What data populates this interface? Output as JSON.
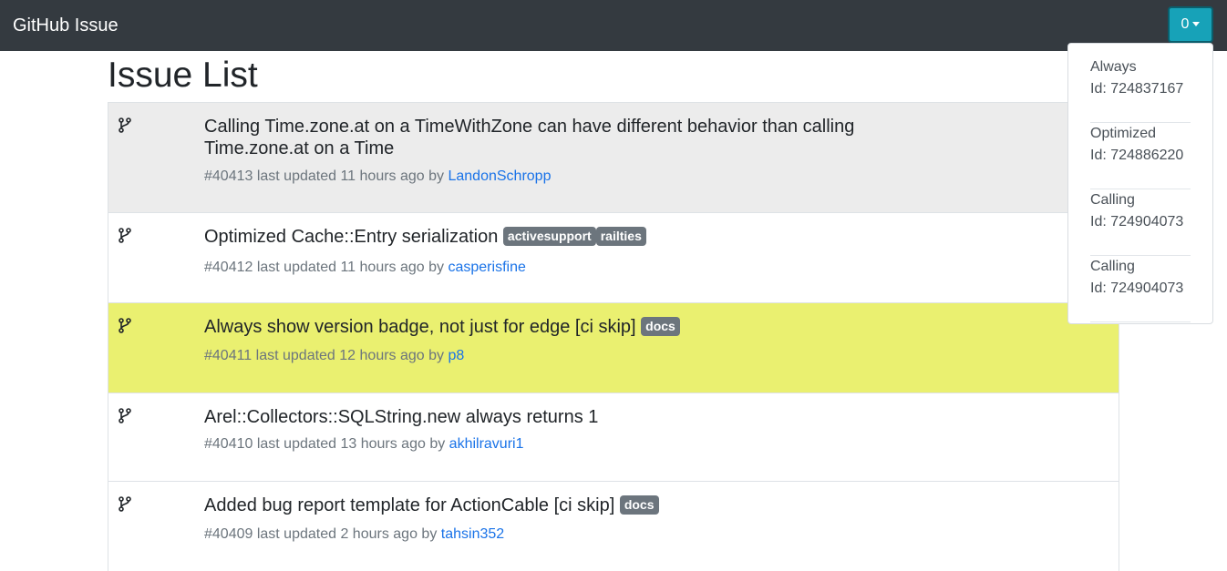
{
  "navbar": {
    "brand": "GitHub Issue",
    "counter_button": "0"
  },
  "page_title": "Issue List",
  "issues": [
    {
      "title": "Calling Time.zone.at on a TimeWithZone can have different behavior than calling Time.zone.at on a Time",
      "labels": [],
      "meta": "#40413 last updated 11 hours ago by",
      "author": "LandonSchropp",
      "background": "#ececec"
    },
    {
      "title": "Optimized Cache::Entry serialization",
      "labels": [
        "activesupport",
        "railties"
      ],
      "meta": "#40412 last updated 11 hours ago by",
      "author": "casperisfine",
      "background": "#ffffff"
    },
    {
      "title": "Always show version badge, not just for edge [ci skip]",
      "labels": [
        "docs"
      ],
      "meta": "#40411 last updated 12 hours ago by",
      "author": "p8",
      "background": "#eaf070"
    },
    {
      "title": "Arel::Collectors::SQLString.new always returns 1",
      "labels": [],
      "meta": "#40410 last updated 13 hours ago by",
      "author": "akhilravuri1",
      "background": "#ffffff"
    },
    {
      "title": "Added bug report template for ActionCable [ci skip]",
      "labels": [
        "docs"
      ],
      "meta": "#40409 last updated 2 hours ago by",
      "author": "tahsin352",
      "background": "#ffffff"
    }
  ],
  "dropdown": {
    "items": [
      {
        "name": "Always",
        "id": "Id: 724837167"
      },
      {
        "name": "Optimized",
        "id": "Id: 724886220"
      },
      {
        "name": "Calling",
        "id": "Id: 724904073"
      },
      {
        "name": "Calling",
        "id": "Id: 724904073"
      }
    ]
  },
  "icons": {
    "issue_icon": "git-branch-icon",
    "caret": "caret-down-icon"
  },
  "colors": {
    "navbar": "#343a40",
    "counter_button": "#17a2b8",
    "label": "#6c757d",
    "link": "#1a73e8",
    "highlight": "#eaf070"
  }
}
